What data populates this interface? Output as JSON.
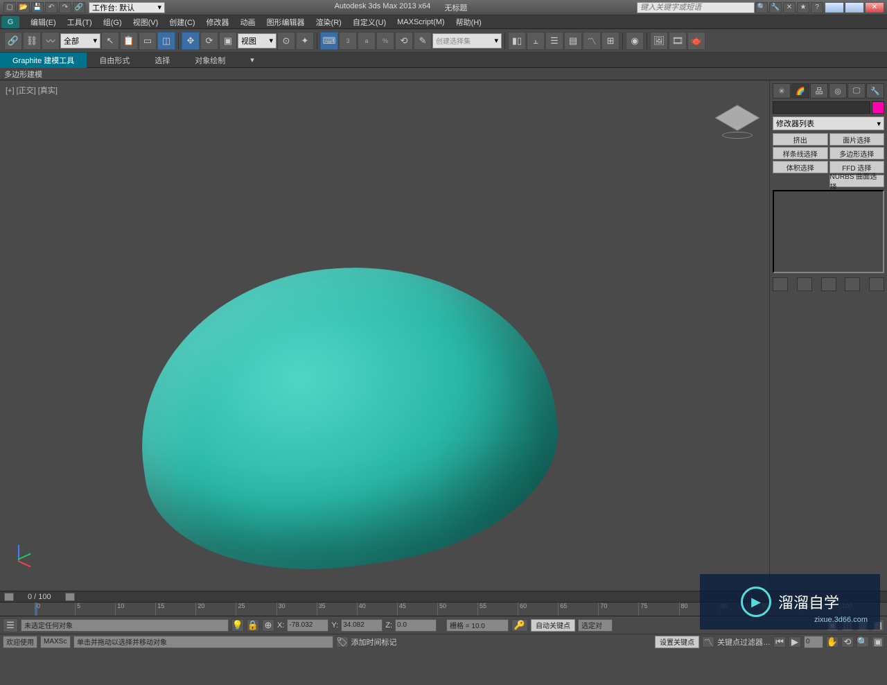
{
  "titlebar": {
    "workspace_label": "工作台: 默认",
    "app_title": "Autodesk 3ds Max  2013 x64",
    "doc_title": "无标题",
    "search_placeholder": "键入关键字或短语"
  },
  "menus": [
    "编辑(E)",
    "工具(T)",
    "组(G)",
    "视图(V)",
    "创建(C)",
    "修改器",
    "动画",
    "图形编辑器",
    "渲染(R)",
    "自定义(U)",
    "MAXScript(M)",
    "帮助(H)"
  ],
  "toolbar": {
    "filter_all": "全部",
    "view_sel": "视图",
    "snap3": "3",
    "angle": "a",
    "percent": "%",
    "named_sel": "创建选择集"
  },
  "ribbon": {
    "tabs": [
      "Graphite 建模工具",
      "自由形式",
      "选择",
      "对象绘制"
    ],
    "sub": "多边形建模"
  },
  "viewport": {
    "label": "[+] [正交] [真实]"
  },
  "cmdpanel": {
    "modlist": "修改器列表",
    "btns": [
      "挤出",
      "面片选择",
      "样条线选择",
      "多边形选择",
      "体积选择",
      "FFD 选择"
    ],
    "nurbs": "NURBS 曲面选择"
  },
  "track": {
    "frame": "0 / 100"
  },
  "timeline_ticks": [
    "0",
    "5",
    "10",
    "15",
    "20",
    "25",
    "30",
    "35",
    "40",
    "45",
    "50",
    "55",
    "60",
    "65",
    "70",
    "75",
    "80",
    "85",
    "90",
    "95",
    "100"
  ],
  "status": {
    "sel_none": "未选定任何对象",
    "x_label": "X:",
    "x_val": "-78.032",
    "y_label": "Y:",
    "y_val": "34.082",
    "z_label": "Z:",
    "z_val": "0.0",
    "grid": "栅格 = 10.0",
    "autokey": "自动关键点",
    "selset": "选定对",
    "setkey": "设置关键点",
    "keyfilter": "关键点过滤器…",
    "frame0": "0",
    "hint": "单击并拖动以选择并移动对象",
    "addtime": "添加时间标记",
    "welcome": "欢迎使用",
    "maxs": "MAXSc"
  },
  "watermark": {
    "text": "溜溜自学",
    "sub": "zixue.3d66.com"
  }
}
